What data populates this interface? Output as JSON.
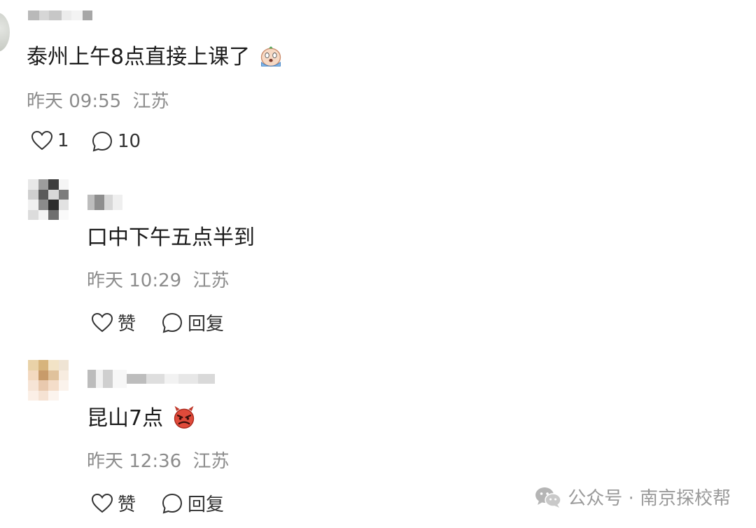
{
  "comments": [
    {
      "text": "泰州上午8点直接上课了",
      "emoji": "crying-face-icon",
      "time": "昨天 09:55",
      "location": "江苏",
      "likes": "1",
      "replies": "10"
    },
    {
      "text": "口中下午五点半到",
      "time": "昨天 10:29",
      "location": "江苏",
      "like_label": "赞",
      "reply_label": "回复"
    },
    {
      "text": "昆山7点",
      "emoji": "angry-devil-icon",
      "time": "昨天 12:36",
      "location": "江苏",
      "like_label": "赞",
      "reply_label": "回复"
    }
  ],
  "watermark": {
    "prefix": "公众号 · ",
    "account": "南京探校帮",
    "icon": "wechat-icon"
  },
  "colors": {
    "meta_gray": "#8c8c8c",
    "text": "#1b1b1b",
    "icon": "#333333"
  }
}
